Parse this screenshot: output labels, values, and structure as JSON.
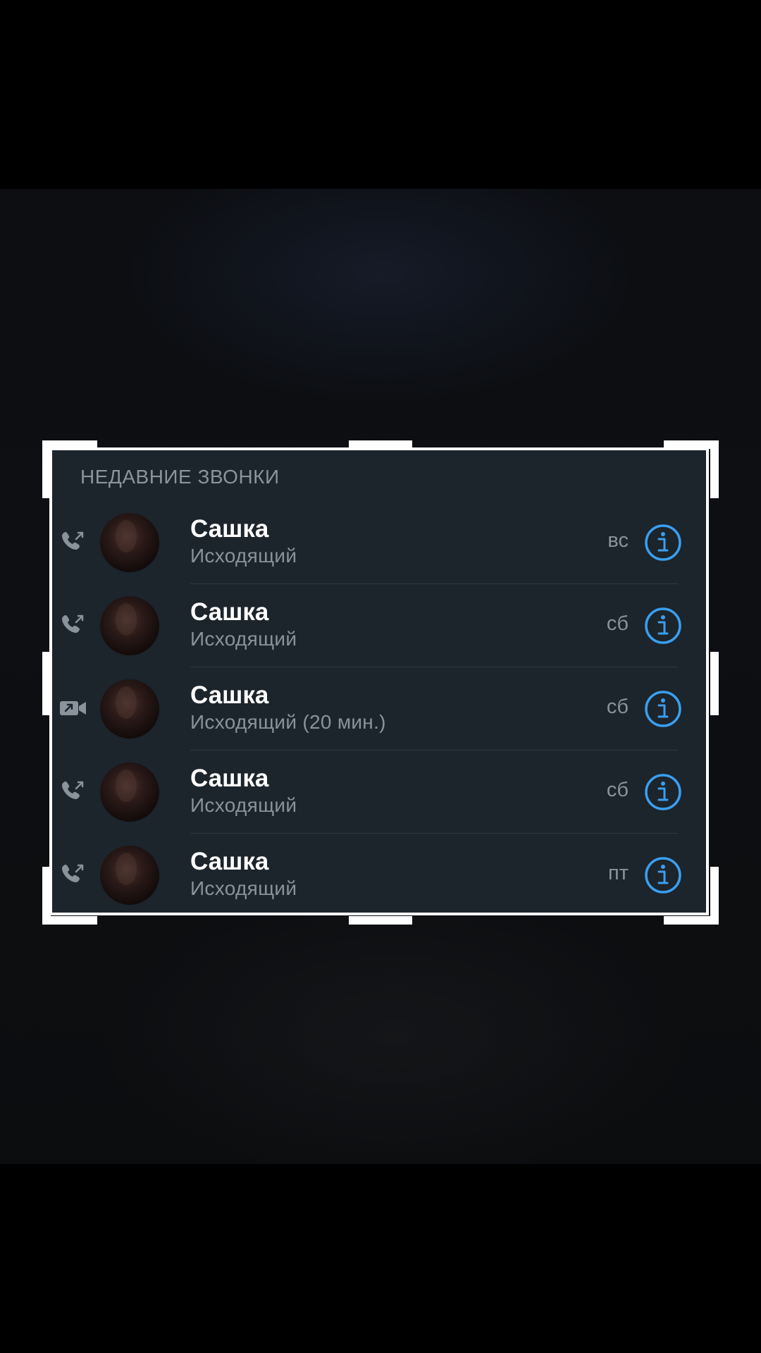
{
  "section": {
    "title": "НЕДАВНИЕ ЗВОНКИ"
  },
  "calls": [
    {
      "name": "Сашка",
      "status": "Исходящий",
      "day": "вс",
      "type_icon": "outgoing-call-icon"
    },
    {
      "name": "Сашка",
      "status": "Исходящий",
      "day": "сб",
      "type_icon": "outgoing-call-icon"
    },
    {
      "name": "Сашка",
      "status": "Исходящий (20 мин.)",
      "day": "сб",
      "type_icon": "outgoing-video-call-icon"
    },
    {
      "name": "Сашка",
      "status": "Исходящий",
      "day": "сб",
      "type_icon": "outgoing-call-icon"
    },
    {
      "name": "Сашка",
      "status": "Исходящий",
      "day": "пт",
      "type_icon": "outgoing-call-icon"
    }
  ],
  "colors": {
    "card_background": "#1c242c",
    "accent": "#3a9ff0",
    "secondary_text": "#8a939c",
    "primary_text": "#ffffff"
  }
}
